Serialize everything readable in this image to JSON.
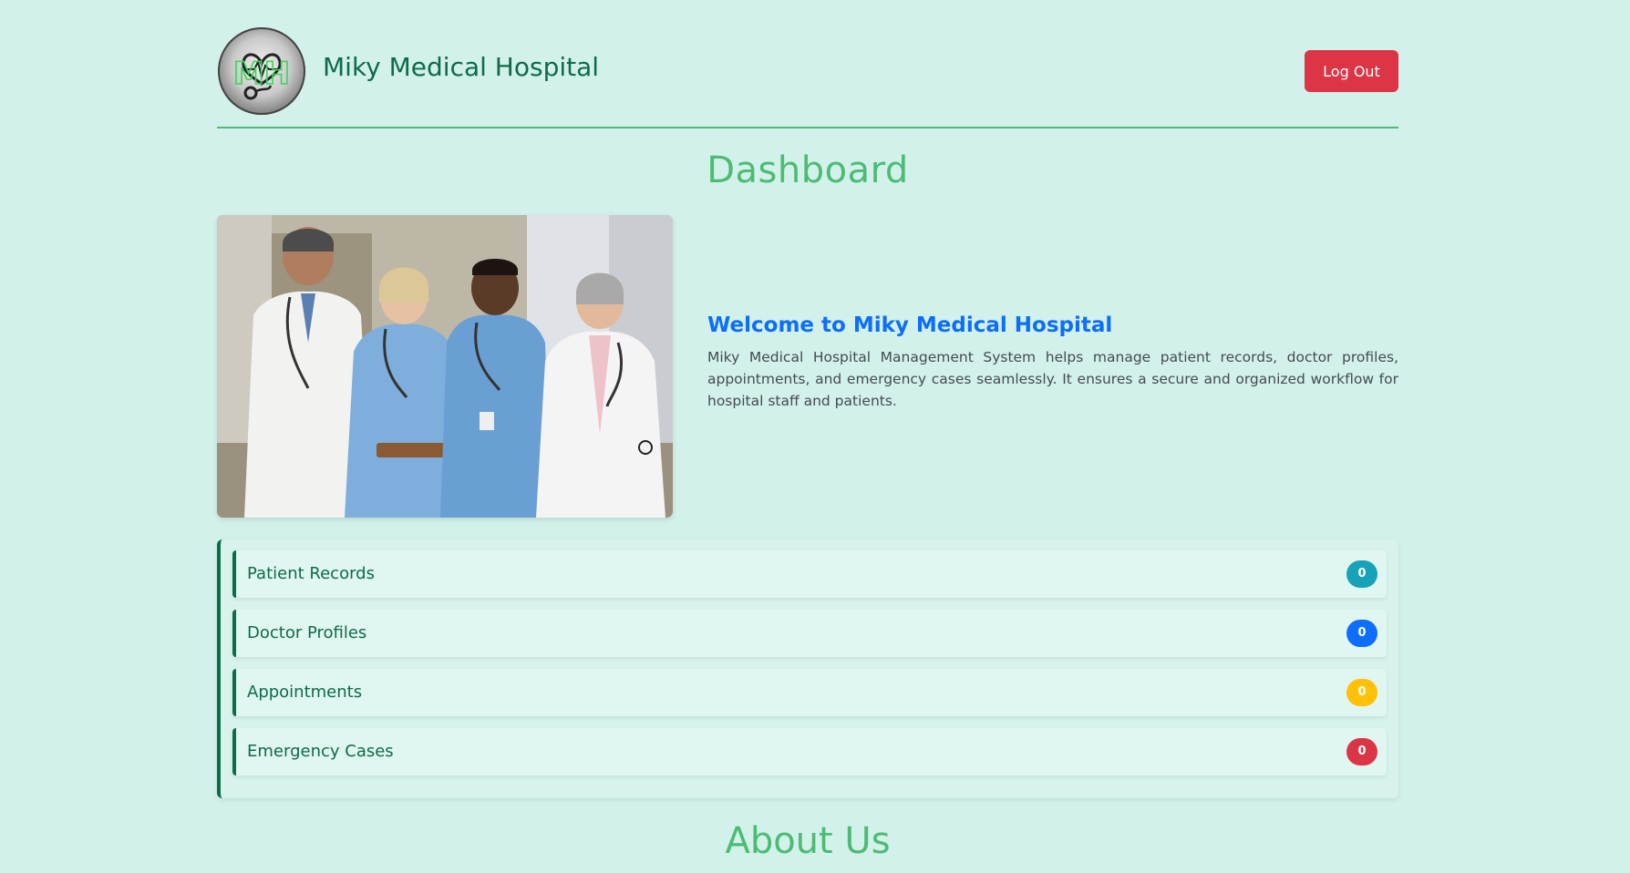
{
  "header": {
    "logo_text": "MH",
    "hospital_name": "Miky Medical Hospital",
    "logout_label": "Log Out"
  },
  "main": {
    "title": "Dashboard",
    "welcome_heading": "Welcome to Miky Medical Hospital",
    "welcome_text": "Miky Medical Hospital Management System helps manage patient records, doctor profiles, appointments, and emergency cases seamlessly. It ensures a secure and organized workflow for hospital staff and patients."
  },
  "stats": [
    {
      "label": "Patient Records",
      "count": "0",
      "color": "#17a2b8"
    },
    {
      "label": "Doctor Profiles",
      "count": "0",
      "color": "#0d6efd"
    },
    {
      "label": "Appointments",
      "count": "0",
      "color": "#ffc107"
    },
    {
      "label": "Emergency Cases",
      "count": "0",
      "color": "#dc3545"
    }
  ],
  "about": {
    "title": "About Us"
  },
  "colors": {
    "background": "#d2f1ea",
    "brand_green": "#4cbc74",
    "dark_green": "#0e6b4a",
    "welcome_blue": "#0d6efd",
    "logout_red": "#dc3545"
  },
  "icons": {
    "logo": "heart-stethoscope-logo-icon"
  }
}
